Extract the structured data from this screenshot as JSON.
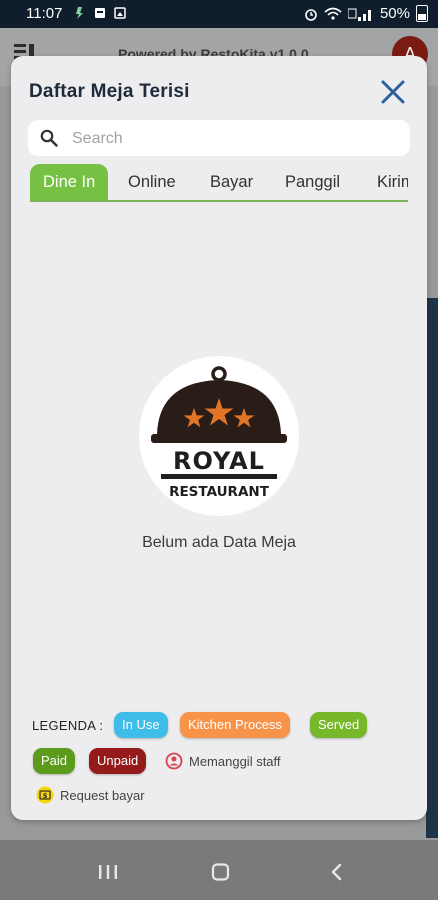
{
  "status_bar": {
    "time": "11:07",
    "battery": "50%"
  },
  "background": {
    "title": "Powered by RestoKita v1.0.0",
    "avatar": "A"
  },
  "modal": {
    "title": "Daftar Meja Terisi",
    "search_placeholder": "Search",
    "tabs": [
      {
        "label": "Dine In",
        "active": true
      },
      {
        "label": "Online",
        "active": false
      },
      {
        "label": "Bayar",
        "active": false
      },
      {
        "label": "Panggil",
        "active": false
      },
      {
        "label": "Kirim",
        "active": false
      }
    ],
    "logo": {
      "line1": "ROYAL",
      "line2": "RESTAURANT"
    },
    "empty_message": "Belum ada Data Meja",
    "legend": {
      "label": "LEGENDA :",
      "in_use": "In Use",
      "kitchen": "Kitchen Process",
      "served": "Served",
      "paid": "Paid",
      "unpaid": "Unpaid",
      "call_staff": "Memanggil staff",
      "request_bill": "Request bayar"
    }
  },
  "colors": {
    "accent_green": "#76c044",
    "in_use": "#3dbde8",
    "kitchen": "#f7944a",
    "served": "#77b82a",
    "paid": "#5d9b1c",
    "unpaid": "#951a1a",
    "call_staff_icon": "#d9434d",
    "request_icon": "#f5d60b",
    "close_icon": "#2b5f9e"
  },
  "icons": [
    "search-icon",
    "close-icon",
    "call-staff-icon",
    "request-bill-icon",
    "recent-apps-icon",
    "home-icon",
    "back-icon"
  ]
}
